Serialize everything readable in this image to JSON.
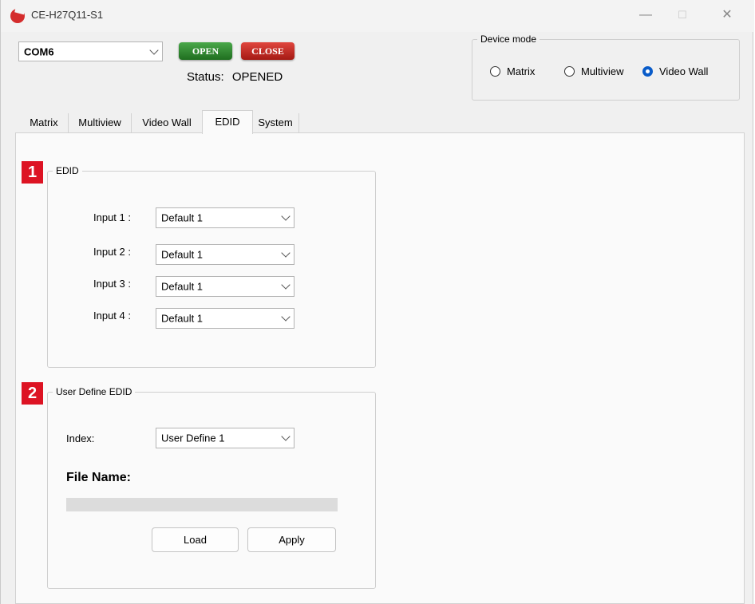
{
  "window": {
    "title": "CE-H27Q11-S1",
    "minimize": "—",
    "maximize": "☐",
    "close": "✕"
  },
  "connection": {
    "port": "COM6",
    "open_label": "OPEN",
    "close_label": "CLOSE",
    "status_label": "Status:",
    "status_value": "OPENED"
  },
  "device_mode": {
    "legend": "Device mode",
    "options": [
      {
        "label": "Matrix",
        "selected": false
      },
      {
        "label": "Multiview",
        "selected": false
      },
      {
        "label": "Video Wall",
        "selected": true
      }
    ]
  },
  "tabs": [
    {
      "label": "Matrix"
    },
    {
      "label": "Multiview"
    },
    {
      "label": "Video Wall"
    },
    {
      "label": "EDID",
      "active": true
    },
    {
      "label": "System"
    }
  ],
  "edid": {
    "badge": "1",
    "legend": "EDID",
    "inputs": [
      {
        "label": "Input 1 :",
        "value": "Default 1"
      },
      {
        "label": "Input 2 :",
        "value": "Default 1"
      },
      {
        "label": "Input 3 :",
        "value": "Default 1"
      },
      {
        "label": "Input 4 :",
        "value": "Default 1"
      }
    ]
  },
  "user_edid": {
    "badge": "2",
    "legend": "User Define EDID",
    "index_label": "Index:",
    "index_value": "User Define 1",
    "file_name_label": "File Name:",
    "load_label": "Load",
    "apply_label": "Apply"
  },
  "colors": {
    "open_button": "#2e8b2e",
    "close_button": "#c4261e",
    "badge": "#dd1323",
    "radio_selected": "#0a5cc9"
  }
}
